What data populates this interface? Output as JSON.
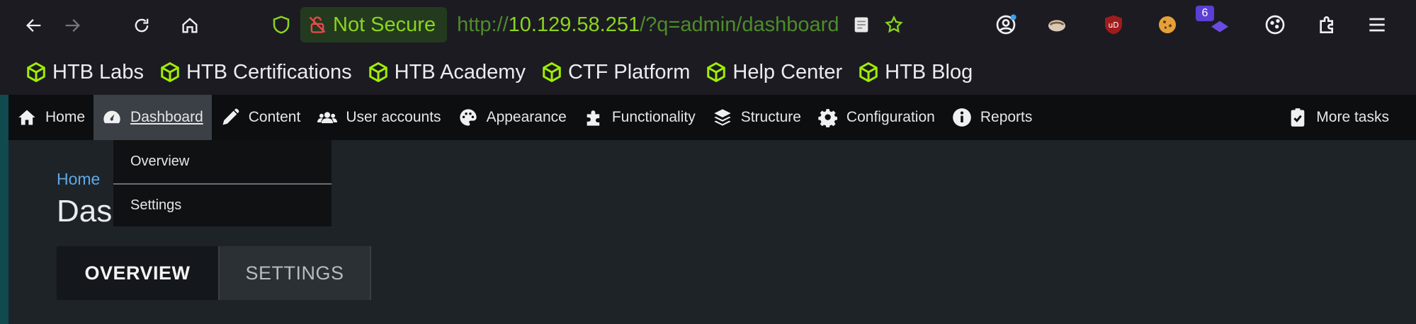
{
  "browser": {
    "security_label": "Not Secure",
    "url_scheme": "http://",
    "url_host": "10.129.58.251",
    "url_path": "/?q=admin/dashboard",
    "extension_badge": "6",
    "accent_color": "#8bd51c",
    "icons": [
      "back-arrow-icon",
      "forward-arrow-icon",
      "reload-icon",
      "home-icon",
      "shield-icon",
      "insecure-lock-icon",
      "reader-view-icon",
      "star-icon",
      "account-icon",
      "extension-icon",
      "ublock-icon",
      "cookie-icon",
      "puzzle-icon",
      "menu-icon"
    ]
  },
  "bookmarks": [
    {
      "label": "HTB Labs"
    },
    {
      "label": "HTB Certifications"
    },
    {
      "label": "HTB Academy"
    },
    {
      "label": "CTF Platform"
    },
    {
      "label": "Help Center"
    },
    {
      "label": "HTB Blog"
    }
  ],
  "admin_bar": {
    "items": [
      {
        "label": "Home",
        "icon": "home-icon"
      },
      {
        "label": "Dashboard",
        "icon": "dashboard-icon"
      },
      {
        "label": "Content",
        "icon": "pencil-icon"
      },
      {
        "label": "User accounts",
        "icon": "users-icon"
      },
      {
        "label": "Appearance",
        "icon": "palette-icon"
      },
      {
        "label": "Functionality",
        "icon": "puzzle-icon"
      },
      {
        "label": "Structure",
        "icon": "layers-icon"
      },
      {
        "label": "Configuration",
        "icon": "gear-icon"
      },
      {
        "label": "Reports",
        "icon": "info-icon"
      }
    ],
    "more_tasks": "More tasks"
  },
  "dashboard_tray": {
    "items": [
      {
        "label": "Overview"
      },
      {
        "label": "Settings"
      }
    ]
  },
  "main": {
    "breadcrumb": "Home",
    "title": "Das",
    "tabs": [
      {
        "label": "OVERVIEW",
        "active": true
      },
      {
        "label": "SETTINGS",
        "active": false
      }
    ]
  }
}
